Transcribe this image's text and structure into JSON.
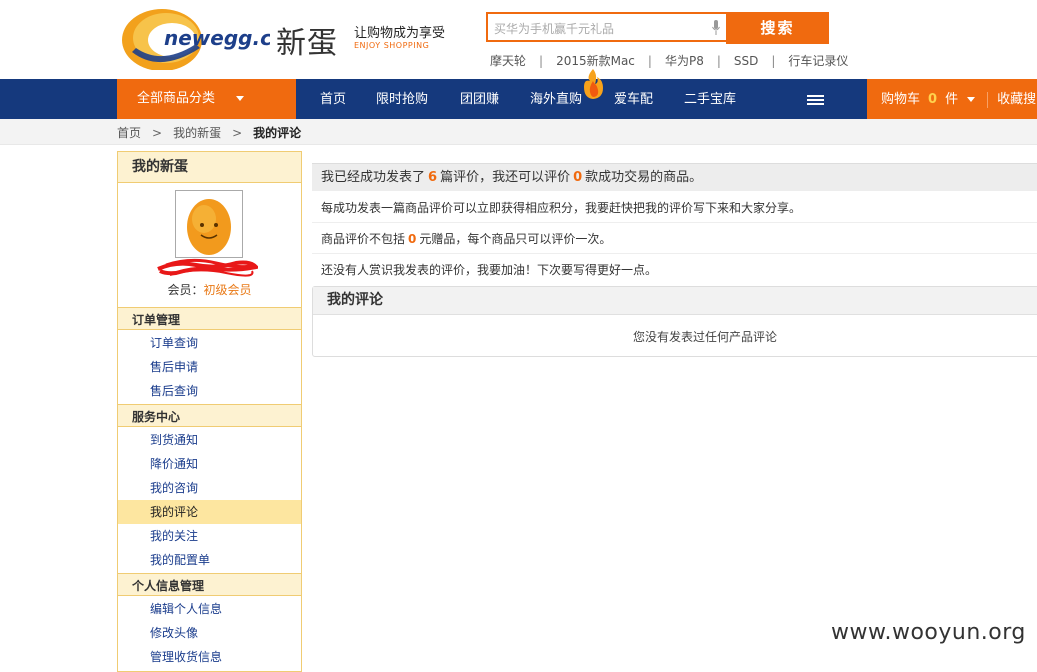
{
  "header": {
    "logo_text": "newegg.cn",
    "logo_cn": "新蛋",
    "slogan": "让购物成为享受",
    "slogan_en": "ENJOY SHOPPING",
    "search_placeholder": "买华为手机赢千元礼品",
    "search_button": "搜索",
    "hot_words": [
      "摩天轮",
      "2015新款Mac",
      "华为P8",
      "SSD",
      "行车记录仪"
    ]
  },
  "nav": {
    "category_label": "全部商品分类",
    "links": [
      "首页",
      "限时抢购",
      "团团赚",
      "海外直购",
      "爱车配",
      "二手宝库"
    ],
    "cart_label": "购物车",
    "cart_count": "0",
    "cart_unit": "件",
    "favorites_label": "收藏搜"
  },
  "breadcrumb": {
    "items": [
      "首页",
      "我的新蛋"
    ],
    "current": "我的评论",
    "separator": ">"
  },
  "sidebar": {
    "title": "我的新蛋",
    "member_prefix": "会员：",
    "member_level": "初级会员",
    "sections": [
      {
        "title": "订单管理",
        "items": [
          "订单查询",
          "售后申请",
          "售后查询"
        ]
      },
      {
        "title": "服务中心",
        "items": [
          "到货通知",
          "降价通知",
          "我的咨询",
          "我的评论",
          "我的关注",
          "我的配置单"
        ]
      },
      {
        "title": "个人信息管理",
        "items": [
          "编辑个人信息",
          "修改头像",
          "管理收货信息"
        ]
      }
    ],
    "active_item": "我的评论"
  },
  "main": {
    "summary_pre": "我已经成功发表了",
    "review_count": "6",
    "summary_mid": "篇评价，我还可以评价",
    "pending_count": "0",
    "summary_post": "款成功交易的商品。",
    "note1": "每成功发表一篇商品评价可以立即获得相应积分，我要赶快把我的评价写下来和大家分享。",
    "note2_pre": "商品评价不包括",
    "note2_count": "0",
    "note2_post": "元赠品，每个商品只可以评价一次。",
    "note3": "还没有人赏识我发表的评价，我要加油！下次要写得更好一点。",
    "panel_title": "我的评论",
    "empty_text": "您没有发表过任何产品评论"
  },
  "watermark": "www.wooyun.org",
  "colors": {
    "brand_orange": "#f06a0f",
    "nav_blue": "#15397d",
    "sidebar_border": "#f0cc73",
    "sidebar_bg": "#fdf2d1"
  }
}
